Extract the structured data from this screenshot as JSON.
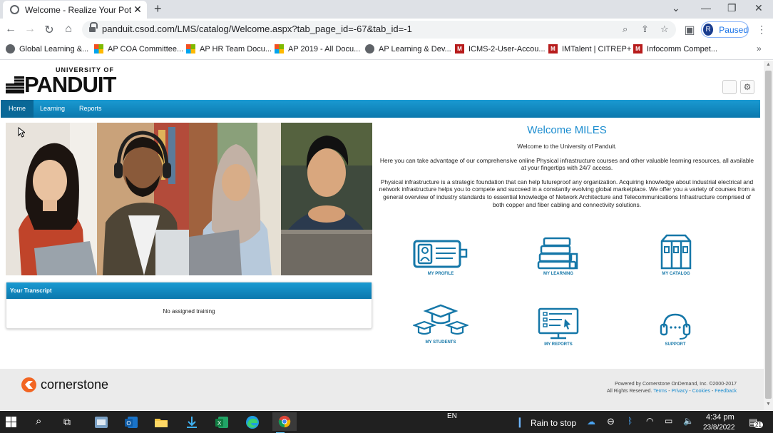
{
  "browser": {
    "tab_title": "Welcome - Realize Your Potential",
    "url": "panduit.csod.com/LMS/catalog/Welcome.aspx?tab_page_id=-67&tab_id=-1",
    "profile_initial": "R",
    "profile_status": "Paused",
    "bookmarks": [
      {
        "label": "Global Learning &...",
        "icon": "globe-icon"
      },
      {
        "label": "AP COA Committee...",
        "icon": "microsoft-icon"
      },
      {
        "label": "AP HR Team Docu...",
        "icon": "microsoft-icon"
      },
      {
        "label": "AP 2019 - All Docu...",
        "icon": "microsoft-icon"
      },
      {
        "label": "AP Learning & Dev...",
        "icon": "globe-icon"
      },
      {
        "label": "ICMS-2-User-Accou...",
        "icon": "imtalent-icon"
      },
      {
        "label": "IMTalent | CITREP+",
        "icon": "imtalent-icon"
      },
      {
        "label": "Infocomm Compet...",
        "icon": "imtalent-icon"
      }
    ]
  },
  "header": {
    "logo_top": "UNIVERSITY OF",
    "logo_main": "PANDUIT"
  },
  "nav": [
    {
      "label": "Home",
      "active": true
    },
    {
      "label": "Learning",
      "active": false
    },
    {
      "label": "Reports",
      "active": false
    }
  ],
  "transcript": {
    "title": "Your Transcript",
    "empty": "No assigned training"
  },
  "welcome": {
    "title": "Welcome MILES",
    "p1": "Welcome to the University of Panduit.",
    "p2": "Here you can take advantage of our comprehensive online Physical infrastructure courses and other valuable learning resources, all available at your fingertips with 24/7 access.",
    "p3": "Physical infrastructure is a strategic foundation that can help futureproof any organization. Acquiring knowledge about industrial electrical and network infrastructure helps you to compete and succeed in a constantly evolving global marketplace. We offer you a variety of courses from a general overview of industry standards to essential knowledge of Network Architecture and Telecommunications Infrastructure comprised of both copper and fiber cabling and connectivity solutions."
  },
  "tiles": [
    {
      "label": "MY PROFILE",
      "icon": "profile-card-icon"
    },
    {
      "label": "MY LEARNING",
      "icon": "books-icon"
    },
    {
      "label": "MY CATALOG",
      "icon": "binders-icon"
    },
    {
      "label": "MY STUDENTS",
      "icon": "graduation-caps-icon"
    },
    {
      "label": "MY REPORTS",
      "icon": "report-screen-icon"
    },
    {
      "label": "SUPPORT",
      "icon": "headset-icon"
    }
  ],
  "footer": {
    "brand": "cornerstone",
    "powered": "Powered by Cornerstone OnDemand, Inc. ©2000-2017",
    "rights": "All Rights Reserved.",
    "links": [
      "Terms",
      "Privacy",
      "Cookies",
      "Feedback"
    ]
  },
  "taskbar": {
    "lang": "EN",
    "weather": "Rain to stop",
    "time": "4:34 pm",
    "date": "23/8/2022",
    "notifications": "21"
  },
  "colors": {
    "accent": "#1a8ccf",
    "nav": "#0b78ad",
    "cornerstone": "#f26522"
  }
}
